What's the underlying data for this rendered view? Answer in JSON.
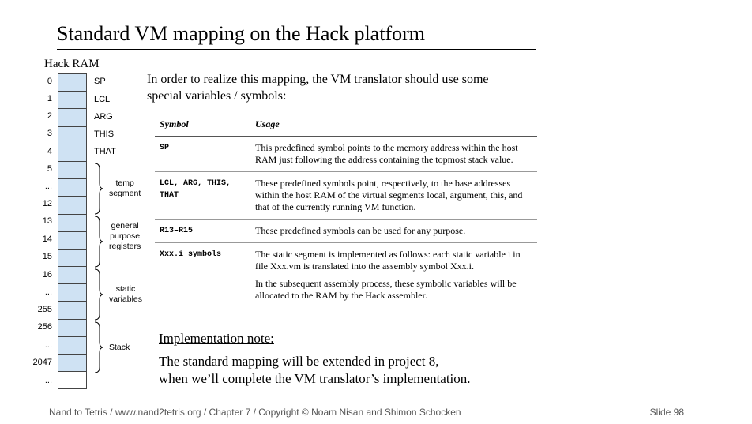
{
  "title": "Standard VM mapping on the Hack platform",
  "ram": {
    "caption": "Hack RAM",
    "addresses": [
      "0",
      "1",
      "2",
      "3",
      "4",
      "5",
      "...",
      "12",
      "13",
      "14",
      "15",
      "16",
      "...",
      "255",
      "256",
      "...",
      "2047",
      "..."
    ],
    "symbols": [
      "SP",
      "LCL",
      "ARG",
      "THIS",
      "THAT"
    ],
    "groups": [
      {
        "label_line1": "temp",
        "label_line2": "segment",
        "label_line3": ""
      },
      {
        "label_line1": "general",
        "label_line2": "purpose",
        "label_line3": "registers"
      },
      {
        "label_line1": "static",
        "label_line2": "variables",
        "label_line3": ""
      },
      {
        "label_line1": "Stack",
        "label_line2": "",
        "label_line3": ""
      }
    ]
  },
  "intro": {
    "line1": "In order to realize this mapping, the VM translator should use some",
    "line2": "special variables / symbols:"
  },
  "table": {
    "headers": [
      "Symbol",
      "Usage"
    ],
    "rows": [
      {
        "symbol": "SP",
        "usage": "This predefined symbol points to the memory address within the host RAM just following the address containing the topmost stack value.",
        "usage2": ""
      },
      {
        "symbol": "LCL, ARG, THIS, THAT",
        "usage": "These predefined symbols point, respectively, to the base addresses within the host RAM of the virtual segments local, argument, this, and that of the currently running VM function.",
        "usage2": ""
      },
      {
        "symbol": "R13–R15",
        "usage": "These predefined symbols can be used for any purpose.",
        "usage2": ""
      },
      {
        "symbol": "Xxx.i symbols",
        "usage": "The static segment is implemented as follows: each static variable i in file Xxx.vm is translated into the assembly symbol Xxx.i.",
        "usage2": "In the subsequent assembly process, these symbolic variables will be allocated to the RAM by the Hack assembler."
      }
    ]
  },
  "implementation": {
    "heading": "Implementation note:",
    "line1": "The standard mapping will be extended in project 8,",
    "line2": "when we’ll complete the VM translator’s implementation."
  },
  "footer": {
    "text": "Nand to Tetris / www.nand2tetris.org / Chapter 7 / Copyright © Noam Nisan and Shimon Schocken",
    "slide": "Slide 98"
  },
  "colors": {
    "ram_cell": "#cfe2f3",
    "footer_text": "#555555"
  }
}
